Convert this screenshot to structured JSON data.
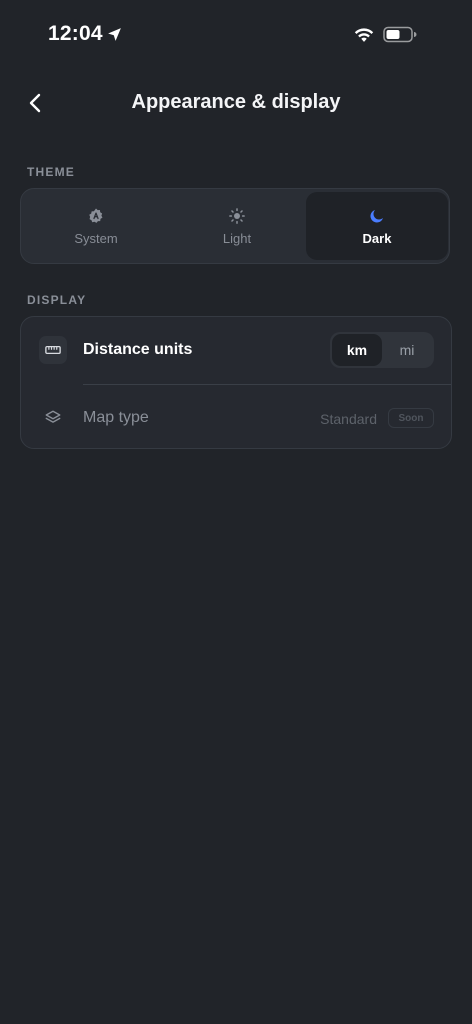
{
  "status_bar": {
    "time": "12:04"
  },
  "nav": {
    "title": "Appearance & display"
  },
  "theme_section": {
    "label": "THEME",
    "options": [
      {
        "label": "System",
        "icon": "auto-theme-icon",
        "selected": false
      },
      {
        "label": "Light",
        "icon": "sun-icon",
        "selected": false
      },
      {
        "label": "Dark",
        "icon": "moon-icon",
        "selected": true
      }
    ]
  },
  "display_section": {
    "label": "DISPLAY",
    "distance_units": {
      "label": "Distance units",
      "icon": "ruler-icon",
      "options": [
        "km",
        "mi"
      ],
      "selected": "km"
    },
    "map_type": {
      "label": "Map type",
      "icon": "layers-icon",
      "value": "Standard",
      "badge": "Soon"
    }
  },
  "colors": {
    "background": "#212429",
    "card": "#2a2e35",
    "accent": "#4a7dff",
    "text_primary": "#ffffff",
    "text_secondary": "#8a8f98"
  }
}
